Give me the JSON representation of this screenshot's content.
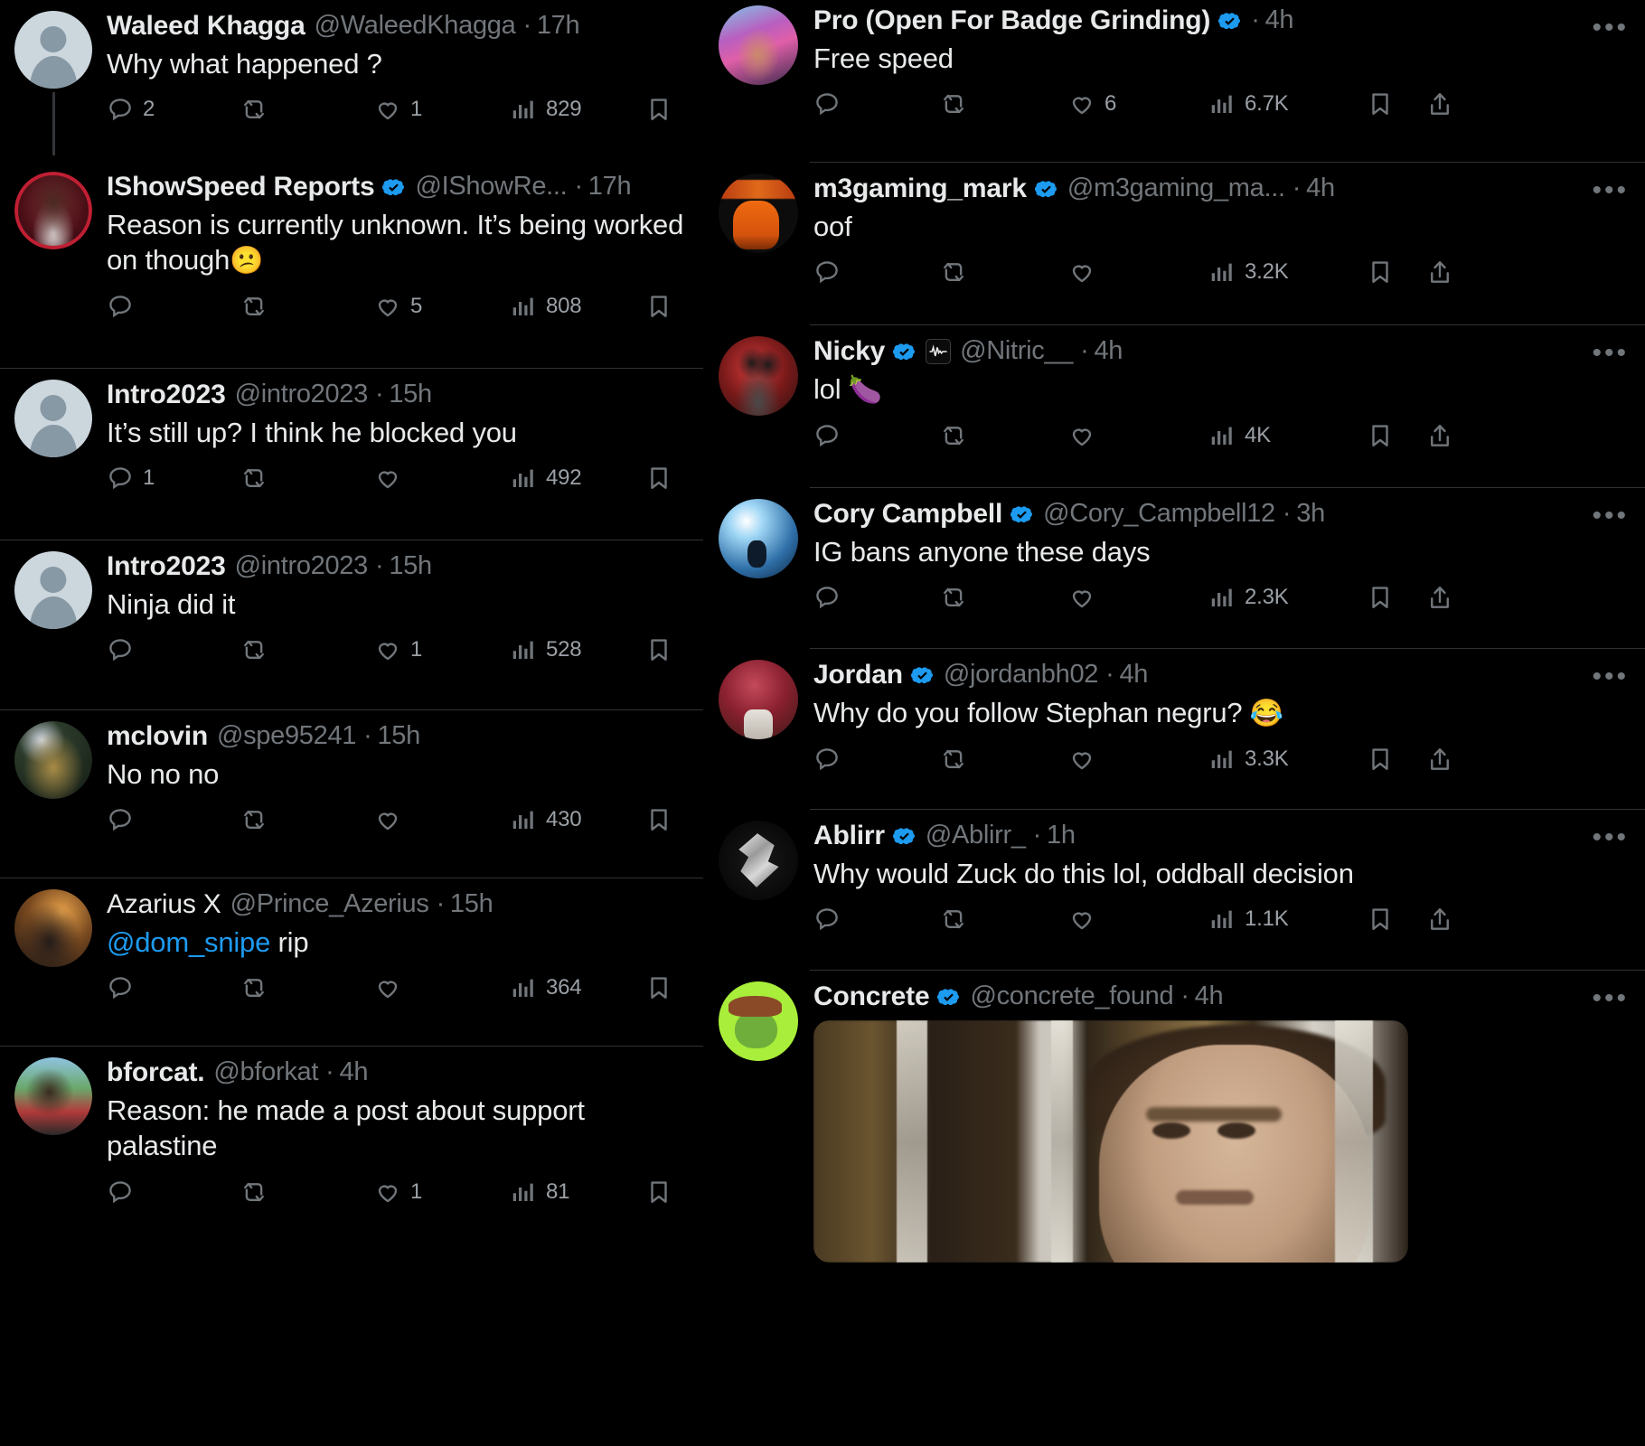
{
  "colors": {
    "background": "#000000",
    "text_primary": "#e7e9ea",
    "text_secondary": "#71767b",
    "link": "#1d9bf0",
    "verified_blue": "#1d9bf0",
    "separator": "#2f3336"
  },
  "icons": {
    "reply": "reply-icon",
    "retweet": "retweet-icon",
    "like": "like-heart-icon",
    "views": "views-bar-chart-icon",
    "bookmark": "bookmark-icon",
    "share": "share-icon",
    "more": "more-options-icon",
    "verified": "verified-badge-icon",
    "affiliate": "affiliate-badge-icon"
  },
  "left_panel": {
    "name": "reply-thread-column",
    "tweets": [
      {
        "display_name": "Waleed Khagga",
        "handle": "@WaleedKhagga",
        "separator": "·",
        "timestamp": "17h",
        "verified": false,
        "text": "Why what happened ?",
        "avatar": "default-egg-avatar",
        "thread_connector": true,
        "replies": "2",
        "retweets": "",
        "likes": "1",
        "views": "829"
      },
      {
        "display_name": "IShowSpeed Reports",
        "handle": "@IShowRe...",
        "separator": "·",
        "timestamp": "17h",
        "verified": true,
        "text": "Reason is currently unknown. It’s being worked on though",
        "emoji": "😕",
        "avatar": "ishowspeed-artwork-avatar",
        "thread_connector": false,
        "replies": "",
        "retweets": "",
        "likes": "5",
        "views": "808"
      },
      {
        "display_name": "Intro2023",
        "handle": "@intro2023",
        "separator": "·",
        "timestamp": "15h",
        "verified": false,
        "text": "It’s still up? I think he blocked you",
        "avatar": "default-egg-avatar",
        "thread_connector": false,
        "replies": "1",
        "retweets": "",
        "likes": "",
        "views": "492"
      },
      {
        "display_name": "Intro2023",
        "handle": "@intro2023",
        "separator": "·",
        "timestamp": "15h",
        "verified": false,
        "text": "Ninja did it",
        "avatar": "default-egg-avatar",
        "thread_connector": false,
        "replies": "",
        "retweets": "",
        "likes": "1",
        "views": "528"
      },
      {
        "display_name": "mclovin",
        "handle": "@spe95241",
        "separator": "·",
        "timestamp": "15h",
        "verified": false,
        "text": "No no no",
        "avatar": "mclovin-photo-avatar",
        "thread_connector": false,
        "replies": "",
        "retweets": "",
        "likes": "",
        "views": "430"
      },
      {
        "display_name": "Azarius X",
        "handle": "@Prince_Azerius",
        "separator": "·",
        "timestamp": "15h",
        "verified": false,
        "mention": "@dom_snipe",
        "text": " rip",
        "avatar": "azarius-anime-avatar",
        "thread_connector": false,
        "replies": "",
        "retweets": "",
        "likes": "",
        "views": "364"
      },
      {
        "display_name": "bforcat.",
        "handle": "@bforkat",
        "separator": "·",
        "timestamp": "4h",
        "verified": false,
        "text": "Reason: he made a post about support palastine",
        "avatar": "bforcat-photo-avatar",
        "thread_connector": false,
        "replies": "",
        "retweets": "",
        "likes": "1",
        "views": "81"
      }
    ]
  },
  "right_panel": {
    "name": "replies-feed-column",
    "tweets": [
      {
        "display_name": "Pro (Open For Badge Grinding)",
        "handle": "",
        "separator": "·",
        "timestamp": "4h",
        "verified": true,
        "text": "Free speed",
        "avatar": "pro-anime-avatar",
        "replies": "",
        "retweets": "",
        "likes": "6",
        "views": "6.7K",
        "more": "•••"
      },
      {
        "display_name": "m3gaming_mark",
        "handle": "@m3gaming_ma...",
        "separator": "·",
        "timestamp": "4h",
        "verified": true,
        "text": "oof",
        "avatar": "m3gaming-logo-avatar",
        "replies": "",
        "retweets": "",
        "likes": "",
        "views": "3.2K",
        "more": "•••"
      },
      {
        "display_name": "Nicky",
        "handle": "@Nitric__",
        "separator": "·",
        "timestamp": "4h",
        "verified": true,
        "affiliate_badge": true,
        "text": "lol",
        "emoji": "🍆",
        "avatar": "nicky-deadpool-avatar",
        "replies": "",
        "retweets": "",
        "likes": "",
        "views": "4K",
        "more": "•••"
      },
      {
        "display_name": "Cory Campbell",
        "handle": "@Cory_Campbell12",
        "separator": "·",
        "timestamp": "3h",
        "verified": true,
        "text": "IG bans anyone these days",
        "avatar": "cory-moon-avatar",
        "replies": "",
        "retweets": "",
        "likes": "",
        "views": "2.3K",
        "more": "•••"
      },
      {
        "display_name": "Jordan",
        "handle": "@jordanbh02",
        "separator": "·",
        "timestamp": "4h",
        "verified": true,
        "text": "Why do you follow Stephan negru?",
        "emoji": "😂",
        "avatar": "jordan-photo-avatar",
        "replies": "",
        "retweets": "",
        "likes": "",
        "views": "3.3K",
        "more": "•••"
      },
      {
        "display_name": "Ablirr",
        "handle": "@Ablirr_",
        "separator": "·",
        "timestamp": "1h",
        "verified": true,
        "text": "Why would Zuck do this lol, oddball decision",
        "avatar": "ablirr-emblem-avatar",
        "replies": "",
        "retweets": "",
        "likes": "",
        "views": "1.1K",
        "more": "•••"
      },
      {
        "display_name": "Concrete",
        "handle": "@concrete_found",
        "separator": "·",
        "timestamp": "4h",
        "verified": true,
        "text": "",
        "avatar": "concrete-frog-avatar",
        "media": "attached-video-thumbnail",
        "more": "•••"
      }
    ]
  }
}
